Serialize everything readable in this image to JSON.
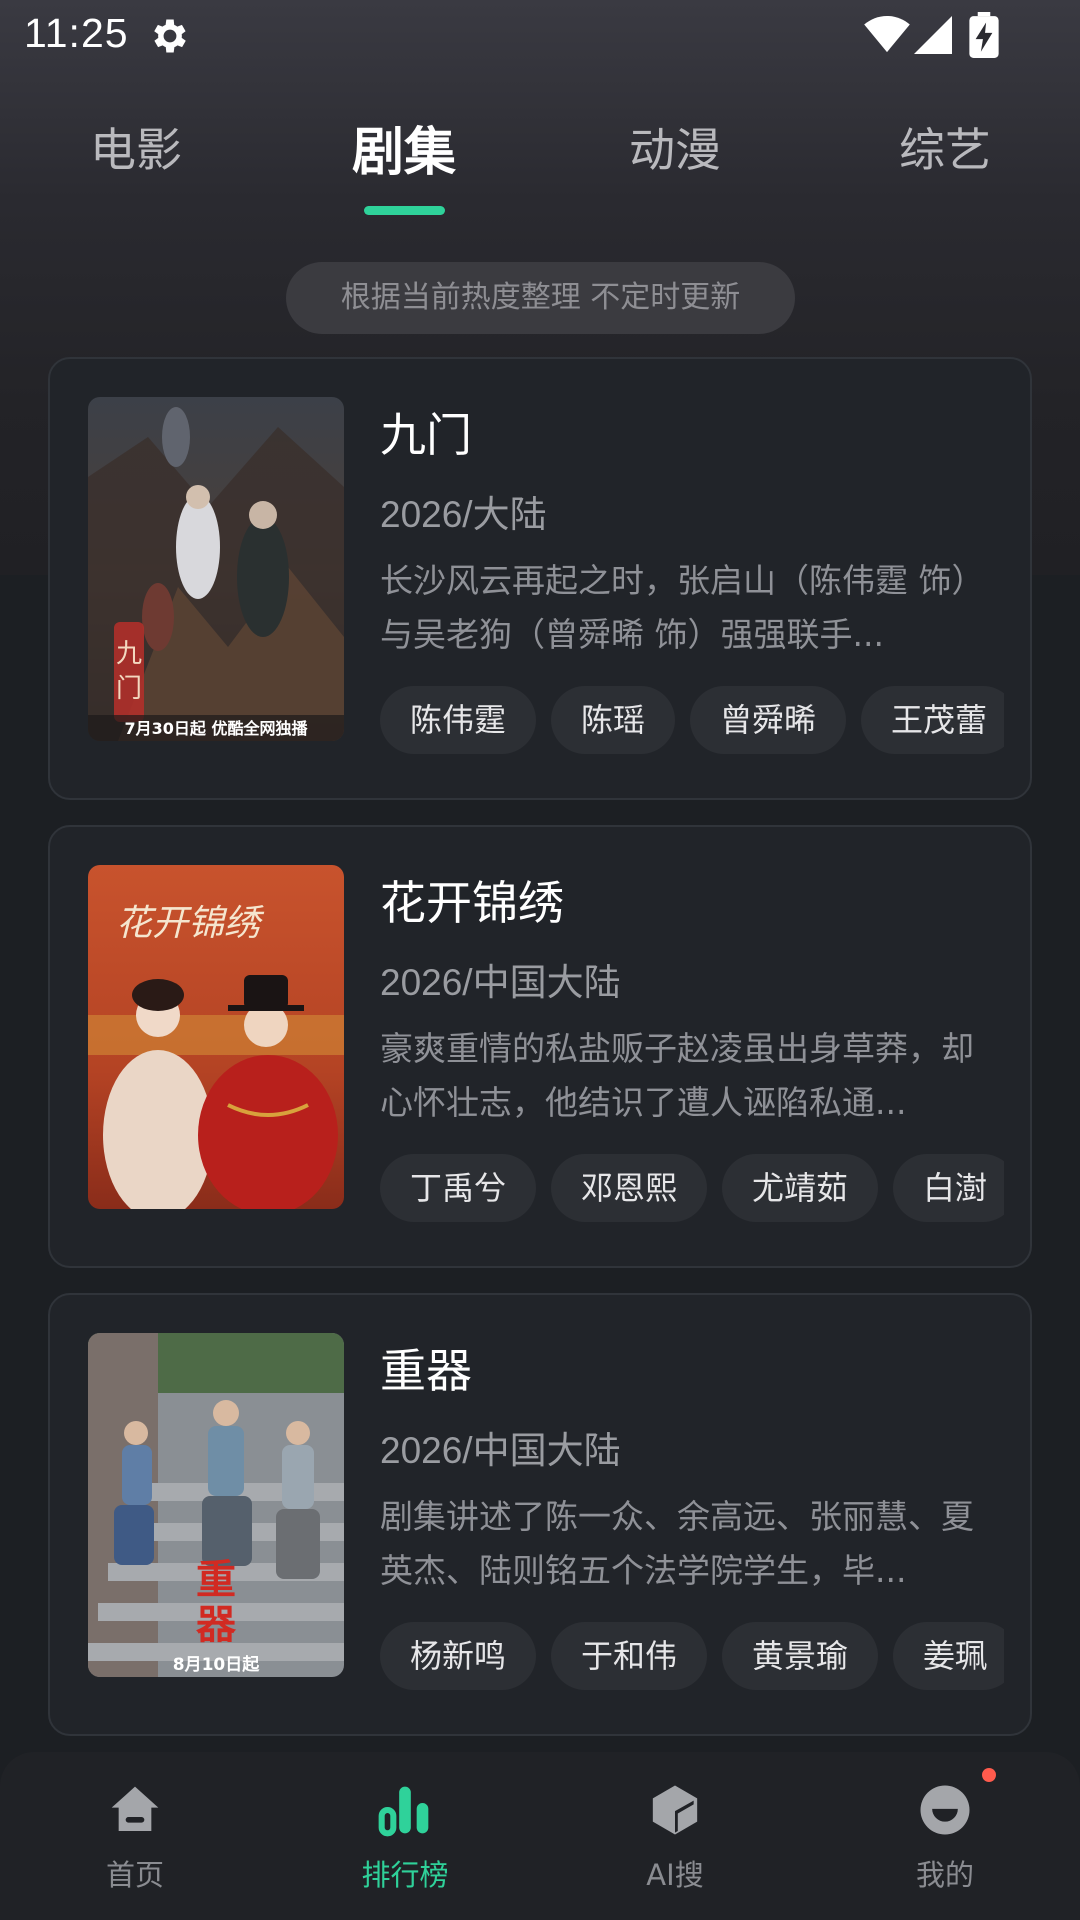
{
  "status_bar": {
    "time": "11:25"
  },
  "tabs": [
    {
      "label": "电影",
      "active": false
    },
    {
      "label": "剧集",
      "active": true
    },
    {
      "label": "动漫",
      "active": false
    },
    {
      "label": "综艺",
      "active": false
    }
  ],
  "notice": "根据当前热度整理 不定时更新",
  "cards": [
    {
      "title": "九门",
      "meta": "2026/大陆",
      "desc": "长沙风云再起之时，张启山（陈伟霆 饰）与吴老狗（曾舜晞 饰）强强联手...",
      "cast": [
        "陈伟霆",
        "陈瑶",
        "曾舜晞",
        "王茂蕾"
      ],
      "poster_text_logo": "九门",
      "poster_caption": "7月30日起 优酷全网独播"
    },
    {
      "title": "花开锦绣",
      "meta": "2026/中国大陆",
      "desc": "豪爽重情的私盐贩子赵凌虽出身草莽，却心怀壮志，他结识了遭人诬陷私通...",
      "cast": [
        "丁禹兮",
        "邓恩熙",
        "尤靖茹",
        "白澍"
      ],
      "poster_text_logo": "花开锦绣"
    },
    {
      "title": "重器",
      "meta": "2026/中国大陆",
      "desc": "剧集讲述了陈一众、余高远、张丽慧、夏英杰、陆则铭五个法学院学生，毕...",
      "cast": [
        "杨新鸣",
        "于和伟",
        "黄景瑜",
        "姜珮"
      ],
      "poster_text_logo": "重器",
      "poster_caption": "8月10日起"
    }
  ],
  "bottom_nav": [
    {
      "label": "首页",
      "icon": "home-icon",
      "active": false
    },
    {
      "label": "排行榜",
      "icon": "ranking-icon",
      "active": true
    },
    {
      "label": "AI搜",
      "icon": "ai-search-icon",
      "active": false
    },
    {
      "label": "我的",
      "icon": "profile-icon",
      "active": false
    }
  ],
  "colors": {
    "accent": "#2fd29a",
    "background": "#1c1f23",
    "card": "#212429",
    "notification_dot": "#ff5b4d"
  }
}
